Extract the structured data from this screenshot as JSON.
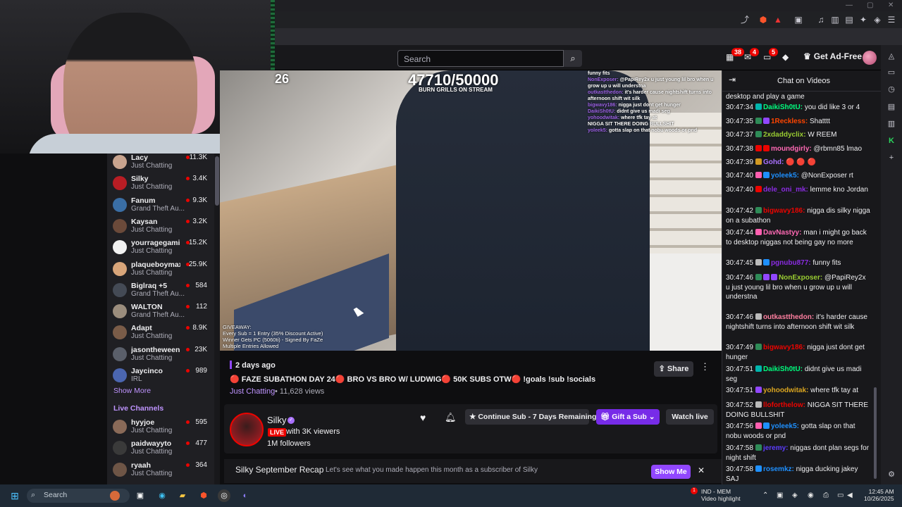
{
  "browser": {
    "toolbar_icons": [
      "share-icon",
      "brave-shield-icon",
      "brave-rewards-icon",
      "pip-icon",
      "music-icon",
      "sidebar-icon",
      "wallet-icon",
      "extensions-icon",
      "vpn-icon",
      "menu-icon"
    ]
  },
  "topnav": {
    "search_placeholder": "Search",
    "notifications": [
      {
        "icon": "prime-icon",
        "count": "38"
      },
      {
        "icon": "inbox-icon",
        "count": "4"
      },
      {
        "icon": "whispers-icon",
        "count": "5"
      },
      {
        "icon": "bits-icon",
        "count": ""
      }
    ],
    "get_adfree": "Get Ad-Free"
  },
  "sidebar": {
    "channels": [
      {
        "name": "Lacy",
        "category": "Just Chatting",
        "viewers": "11.3K",
        "avatar": "#c9a48f"
      },
      {
        "name": "Silky",
        "category": "Just Chatting",
        "viewers": "3.4K",
        "avatar": "#b81d24"
      },
      {
        "name": "Fanum",
        "category": "Grand Theft Au...",
        "viewers": "9.3K",
        "avatar": "#3a6ea5"
      },
      {
        "name": "Kaysan",
        "category": "Just Chatting",
        "viewers": "3.2K",
        "avatar": "#6b4a3a"
      },
      {
        "name": "yourragegami...",
        "category": "Just Chatting",
        "viewers": "15.2K",
        "avatar": "#f2f2f2"
      },
      {
        "name": "plaqueboymax",
        "category": "Just Chatting",
        "viewers": "25.9K",
        "avatar": "#d8a57a"
      },
      {
        "name": "Biglraq +5",
        "category": "Grand Theft Au...",
        "viewers": "584",
        "avatar": "#444a55"
      },
      {
        "name": "WALTON",
        "category": "Grand Theft Au...",
        "viewers": "112",
        "avatar": "#9b8d7d"
      },
      {
        "name": "Adapt",
        "category": "Just Chatting",
        "viewers": "8.9K",
        "avatar": "#7a5c48"
      },
      {
        "name": "jasontheween",
        "category": "Just Chatting",
        "viewers": "23K",
        "avatar": "#5a5f6a"
      },
      {
        "name": "Jaycinco",
        "category": "IRL",
        "viewers": "989",
        "avatar": "#4b66b0"
      }
    ],
    "show_more": "Show More",
    "live_channels_heading": "Live Channels",
    "live_channels": [
      {
        "name": "hyyjoe",
        "category": "Just Chatting",
        "viewers": "595",
        "avatar": "#8a6a58"
      },
      {
        "name": "paidwayyto",
        "category": "Just Chatting",
        "viewers": "477",
        "avatar": "#3a3a3a"
      },
      {
        "name": "ryaah",
        "category": "Just Chatting",
        "viewers": "364",
        "avatar": "#6e5546"
      }
    ]
  },
  "video": {
    "timer": "26",
    "sub_counter": "47710/50000",
    "sub_goal_label": "BURN GRILLS ON STREAM",
    "giveaway": "GIVEAWAY:\nEvery Sub = 1 Entry (35% Discount Active)\nWinner Gets PC (5060ti) - Signed By FaZe\nMultiple Entries Allowed",
    "overlay_chat": [
      {
        "user": "",
        "text": "funny fits"
      },
      {
        "user": "NonExposer:",
        "text": "@PapiRey2x u just young lil bro when u grow up u will understna"
      },
      {
        "user": "outkastthedon:",
        "text": "it's harder cause nightshift turns into afternoon shift wit silk"
      },
      {
        "user": "bigwavy186:",
        "text": "nigga just dont get hunger"
      },
      {
        "user": "DaikiSh0tU:",
        "text": "didnt give us madi seg"
      },
      {
        "user": "yohoodwitak:",
        "text": "where tfk tay at"
      },
      {
        "user": "",
        "text": "NIGGA SIT THERE DOING BULLSHIT"
      },
      {
        "user": "yoleek5:",
        "text": "gotta slap on that nobu woods or pnd"
      }
    ]
  },
  "meta": {
    "date": "2 days ago",
    "title": "🔴 FAZE SUBATHON DAY 24🔴 BRO VS BRO W/ LUDWIG🔴 50K SUBS OTW🔴 !goals !sub !socials",
    "category": "Just Chatting",
    "views": "11,628 views",
    "share": "Share"
  },
  "channel": {
    "name": "Silky",
    "live_tag": "LIVE",
    "viewers_text": "with 3K viewers",
    "followers": "1M followers",
    "continue_sub": "Continue Sub - 7 Days Remaining",
    "gift_sub": "Gift a Sub",
    "watch_live": "Watch live"
  },
  "recap": {
    "title": "Silky September Recap",
    "text": "Let's see what you made happen this month as a subscriber of Silky",
    "button": "Show Me"
  },
  "chat": {
    "title": "Chat on Videos",
    "messages": [
      {
        "ts": "",
        "user": "",
        "color": "#efeff1",
        "text": "desktop and play a game",
        "badges": []
      },
      {
        "ts": "30:47:34",
        "user": "DaikiSh0tU:",
        "color": "#00ff7f",
        "text": "you did like 3 or 4",
        "badges": [
          "#00b5ad"
        ]
      },
      {
        "ts": "30:47:35",
        "user": "1Reckless:",
        "color": "#ff4500",
        "text": "Shatttt",
        "badges": [
          "#2e8b57",
          "#9147ff"
        ]
      },
      {
        "ts": "30:47:37",
        "user": "2xdaddyclix:",
        "color": "#9acd32",
        "text": "W REEM",
        "badges": [
          "#2e8b57"
        ]
      },
      {
        "ts": "30:47:38",
        "user": "moundgirly:",
        "color": "#ff69b4",
        "text": "@rbmn85 lmao",
        "badges": [
          "#eb0400",
          "#eb0400"
        ]
      },
      {
        "ts": "30:47:39",
        "user": "Gohd:",
        "color": "#a970ff",
        "text": "🔴 🔴 🔴",
        "badges": [
          "#d29922"
        ]
      },
      {
        "ts": "30:47:40",
        "user": "yoleek5:",
        "color": "#1e90ff",
        "text": "@NonExposer rt",
        "badges": [
          "#ff5fb0",
          "#1e90ff"
        ]
      },
      {
        "ts": "30:47:40",
        "user": "dele_oni_mk:",
        "color": "#8a2be2",
        "text": "lemme kno Jordan",
        "badges": [
          "#eb0400"
        ]
      },
      {
        "ts": "30:47:42",
        "user": "bigwavy186:",
        "color": "#eb0400",
        "text": "nigga dis silky nigga on a subathon",
        "badges": [
          "#2e8b57"
        ]
      },
      {
        "ts": "30:47:44",
        "user": "DavNastyy:",
        "color": "#ff69b4",
        "text": "man i might go back to desktop niggas not being gay no more",
        "badges": [
          "#ff5fb0"
        ]
      },
      {
        "ts": "30:47:45",
        "user": "pgnubu877:",
        "color": "#8a2be2",
        "text": "funny fits",
        "badges": [
          "#bbbbbb",
          "#1e90ff"
        ]
      },
      {
        "ts": "30:47:46",
        "user": "NonExposer:",
        "color": "#9acd32",
        "text": "@PapiRey2x u just young lil bro when u grow up u will understna",
        "badges": [
          "#2e8b57",
          "#9147ff",
          "#9147ff"
        ]
      },
      {
        "ts": "30:47:46",
        "user": "outkastthedon:",
        "color": "#ff7fa0",
        "text": "it's harder cause nightshift turns into afternoon shift wit silk",
        "badges": [
          "#bbbbbb"
        ]
      },
      {
        "ts": "30:47:49",
        "user": "bigwavy186:",
        "color": "#eb0400",
        "text": "nigga just dont get hunger",
        "badges": [
          "#2e8b57"
        ]
      },
      {
        "ts": "30:47:51",
        "user": "DaikiSh0tU:",
        "color": "#00ff7f",
        "text": "didnt give us madi seg",
        "badges": [
          "#00b5ad"
        ]
      },
      {
        "ts": "30:47:51",
        "user": "yohoodwitak:",
        "color": "#daa520",
        "text": "where tfk tay at",
        "badges": [
          "#9147ff"
        ]
      },
      {
        "ts": "30:47:52",
        "user": "lloforthelow:",
        "color": "#eb0400",
        "text": "NIGGA SIT THERE DOING BULLSHIT",
        "badges": [
          "#bbbbbb"
        ]
      },
      {
        "ts": "30:47:56",
        "user": "yoleek5:",
        "color": "#1e90ff",
        "text": "gotta slap on that nobu woods or pnd",
        "badges": [
          "#ff5fb0",
          "#1e90ff"
        ]
      },
      {
        "ts": "30:47:58",
        "user": "jeremy:",
        "color": "#5b3cff",
        "text": "niggas dont plan segs for night shift",
        "badges": [
          "#2e8b57"
        ]
      },
      {
        "ts": "30:47:58",
        "user": "rosemkz:",
        "color": "#1e90ff",
        "text": "nigga ducking jakey SAJ",
        "badges": [
          "#1e90ff"
        ]
      }
    ]
  },
  "taskbar": {
    "search": "Search",
    "news_title": "IND - MEM",
    "news_sub": "Video highlight",
    "time": "12:45 AM",
    "date": "10/26/2025"
  },
  "colors": {
    "accent": "#9147ff",
    "live": "#eb0400",
    "bg": "#0e0e10",
    "panel": "#18181b"
  }
}
